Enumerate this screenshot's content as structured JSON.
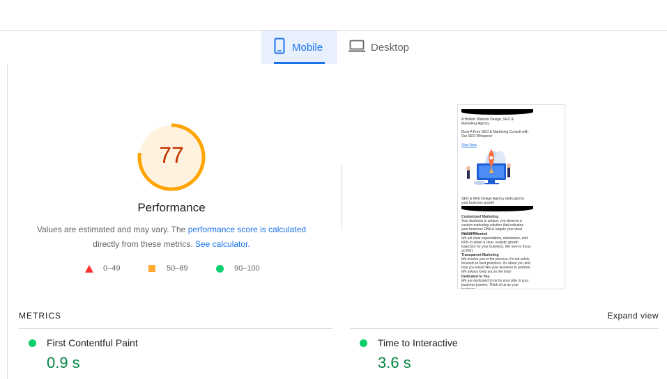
{
  "tabs": [
    {
      "label": "Mobile",
      "active": true,
      "icon": "smartphone-icon"
    },
    {
      "label": "Desktop",
      "active": false,
      "icon": "laptop-icon"
    }
  ],
  "score": {
    "value": "77",
    "fraction": 0.77,
    "label": "Performance",
    "color": "#c33300",
    "ring_color": "#ffa400",
    "ring_bg": "#fff3e0"
  },
  "description": {
    "part1": "Values are estimated and may vary. The",
    "link1": "performance score is calculated",
    "part2": "directly from these metrics.",
    "link2": "See calculator."
  },
  "legend": [
    {
      "range": "0–49",
      "shape": "triangle",
      "color": "#ff3333"
    },
    {
      "range": "50–89",
      "shape": "square",
      "color": "#ffaa33"
    },
    {
      "range": "90–100",
      "shape": "circle",
      "color": "#0cce6b"
    }
  ],
  "screenshot": {
    "heading": "A Holistic Website Design, SEO & Marketing Agency",
    "offer": "Book A Free SEO & Marketing Consult with Our SEO Whisperer",
    "cta": "Start Now",
    "agency": "SEO & Web Design Agency dedicated to your business growth",
    "sections": [
      {
        "title": "Customized Marketing",
        "body": "Your business is unique, you deserve a custom marketing solution that indicates your business DNA & targets your ideal customers."
      },
      {
        "title": "Result Oriented",
        "body": "We set clear expectations, milestones, and KPIs to attain a clear, realistic growth trajectory for your business. We love to focus on ROI."
      },
      {
        "title": "Transparent Marketing",
        "body": "We involve you in the process, it's not solely focused on best practices. It's about you and how you would like your business to perform. We always keep you in the loop!"
      },
      {
        "title": "Dedicated to You",
        "body": "We are dedicated to be by your side in your business journey. Think of us as your business"
      }
    ]
  },
  "metrics": {
    "heading": "METRICS",
    "expand_label": "Expand view",
    "items": [
      {
        "name": "First Contentful Paint",
        "value": "0.9 s",
        "status": "good"
      },
      {
        "name": "Time to Interactive",
        "value": "3.6 s",
        "status": "good"
      }
    ]
  }
}
